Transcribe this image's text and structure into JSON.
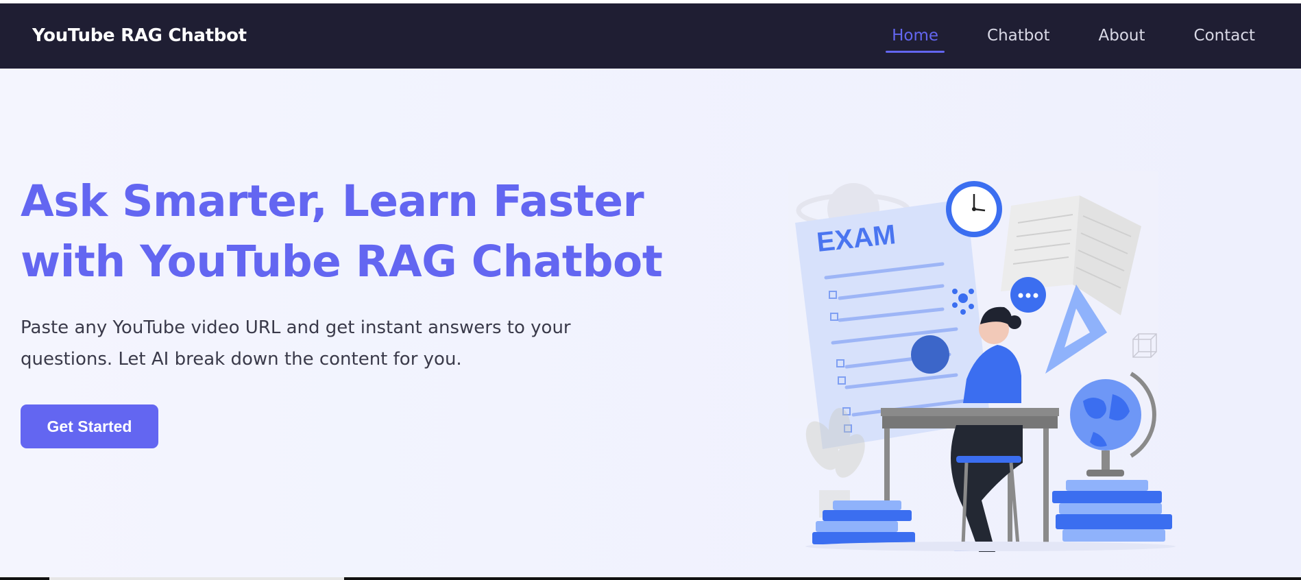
{
  "brand": {
    "title": "YouTube RAG Chatbot"
  },
  "nav": {
    "items": [
      {
        "label": "Home",
        "active": true
      },
      {
        "label": "Chatbot",
        "active": false
      },
      {
        "label": "About",
        "active": false
      },
      {
        "label": "Contact",
        "active": false
      }
    ]
  },
  "hero": {
    "headline_line1": "Ask Smarter, Learn Faster",
    "headline_line2": "with YouTube RAG Chatbot",
    "subtext": "Paste any YouTube video URL and get instant answers to your questions. Let AI break down the content for you.",
    "cta_label": "Get Started"
  },
  "illustration": {
    "exam_label": "EXAM",
    "icons": [
      "clock-icon",
      "chat-bubble-icon",
      "globe-icon",
      "book-icon",
      "ruler-icon",
      "books-icon",
      "planet-icon"
    ]
  },
  "colors": {
    "navbar_bg": "#1f1e33",
    "accent": "#6366f1",
    "hero_bg": "#f2f3fe",
    "text_dark": "#3a3a4a"
  }
}
